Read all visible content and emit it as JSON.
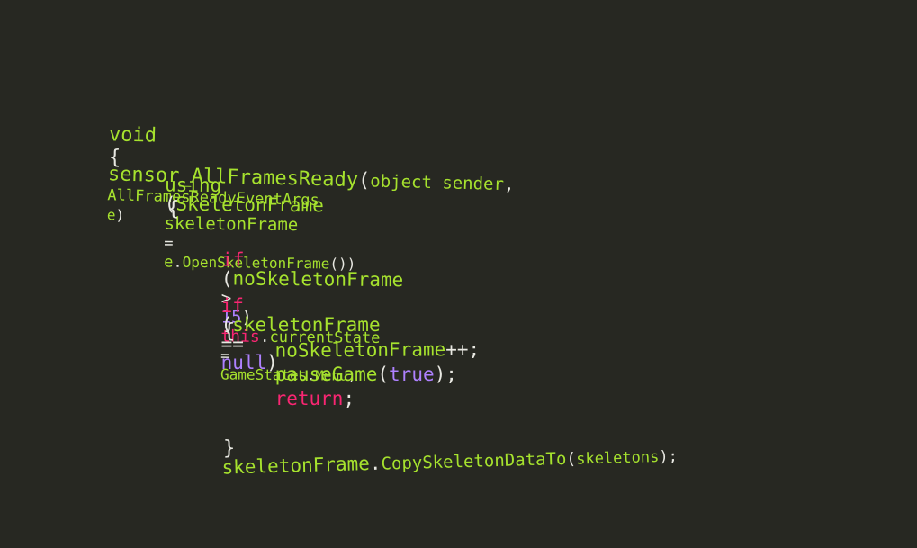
{
  "colors": {
    "background": "#272822",
    "identifier": "#a6e22e",
    "keyword_pink": "#f92672",
    "literal_purple": "#ae81ff",
    "punctuation": "#e8e8e2"
  },
  "code": {
    "l1": {
      "void": "void",
      "method": "sensor_AllFramesReady",
      "paren_open": "(",
      "object_sender": "object sender",
      "comma": ",",
      "args_type": "AllFramesReadyEventArgs",
      "e": "e",
      "paren_close": ")"
    },
    "l2": {
      "brace": "{"
    },
    "l3": {
      "using": "using",
      "paren_open": "(",
      "type": "SkeletonFrame",
      "var": "skeletonFrame",
      "eq": "=",
      "e": "e",
      "dot": ".",
      "call": "OpenSkeletonFrame",
      "parens": "())"
    },
    "l4": {
      "brace": "{"
    },
    "l5": {
      "if": "if",
      "paren_open": "(",
      "var": "noSkeletonFrame",
      "gt": ">",
      "num": "15",
      "paren_close": ")",
      "this": "this",
      "dot": ".",
      "prop": "currentState",
      "eq": "=",
      "enum": "GameStates",
      "dot2": ".",
      "member": "Menu",
      "semi": ";"
    },
    "l6": {
      "if": "if",
      "paren_open": "(",
      "var": "skeletonFrame",
      "eqeq": "==",
      "null": "null",
      "paren_close": ")"
    },
    "l7": {
      "brace": "{"
    },
    "l8": {
      "var": "noSkeletonFrame",
      "op": "++;"
    },
    "l9": {
      "call": "pauseGame",
      "paren_open": "(",
      "arg": "true",
      "paren_close": ");"
    },
    "l10": {
      "return": "return",
      "semi": ";"
    },
    "l11": {
      "brace": "}"
    },
    "l12": {
      "var": "skeletonFrame",
      "dot": ".",
      "call": "CopySkeletonDataTo",
      "paren_open": "(",
      "arg": "skeletons",
      "paren_close": ");"
    }
  }
}
